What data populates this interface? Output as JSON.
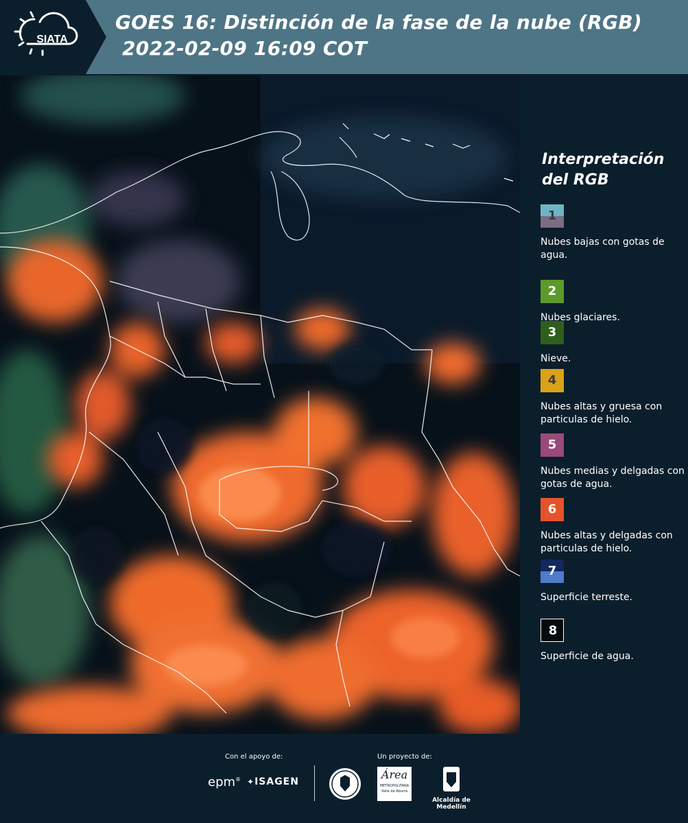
{
  "header": {
    "logo_text": "SIATA",
    "title_line1": "GOES 16: Distinción de la fase de la nube (RGB)",
    "title_line2": "2022-02-09 16:09 COT"
  },
  "legend": {
    "title_line1": "Interpretación",
    "title_line2": "del RGB",
    "items": [
      {
        "num": "1",
        "desc": "Nubes bajas con gotas de agua.",
        "colors": [
          "#6fb6c4",
          "#7c6c84"
        ]
      },
      {
        "num": "2",
        "desc": "Nubes glaciares.",
        "colors": [
          "#5c9a2a"
        ]
      },
      {
        "num": "3",
        "desc": "Nieve.",
        "colors": [
          "#2e5f1d"
        ]
      },
      {
        "num": "4",
        "desc": "Nubes altas y gruesa con particulas de hielo.",
        "colors": [
          "#d9a217"
        ]
      },
      {
        "num": "5",
        "desc": "Nubes medias y delgadas con gotas de agua.",
        "colors": [
          "#9a4a7a"
        ]
      },
      {
        "num": "6",
        "desc": "Nubes altas y delgadas con particulas de hielo.",
        "colors": [
          "#e6532a"
        ]
      },
      {
        "num": "7",
        "desc": "Superficie terreste.",
        "colors": [
          "#13285e",
          "#4f7bc9"
        ]
      },
      {
        "num": "8",
        "desc": "Superficie de agua.",
        "colors": [
          "#050b0b"
        ]
      }
    ]
  },
  "footer": {
    "support_label": "Con el apoyo de:",
    "project_label": "Un proyecto de:",
    "sponsor1": "epm",
    "sponsor2": "ISAGEN",
    "area_name": "Área",
    "area_sub1": "METROPOLITANA",
    "area_sub2": "Valle de Aburrá",
    "alcaldia": "Alcaldía de Medellín"
  }
}
